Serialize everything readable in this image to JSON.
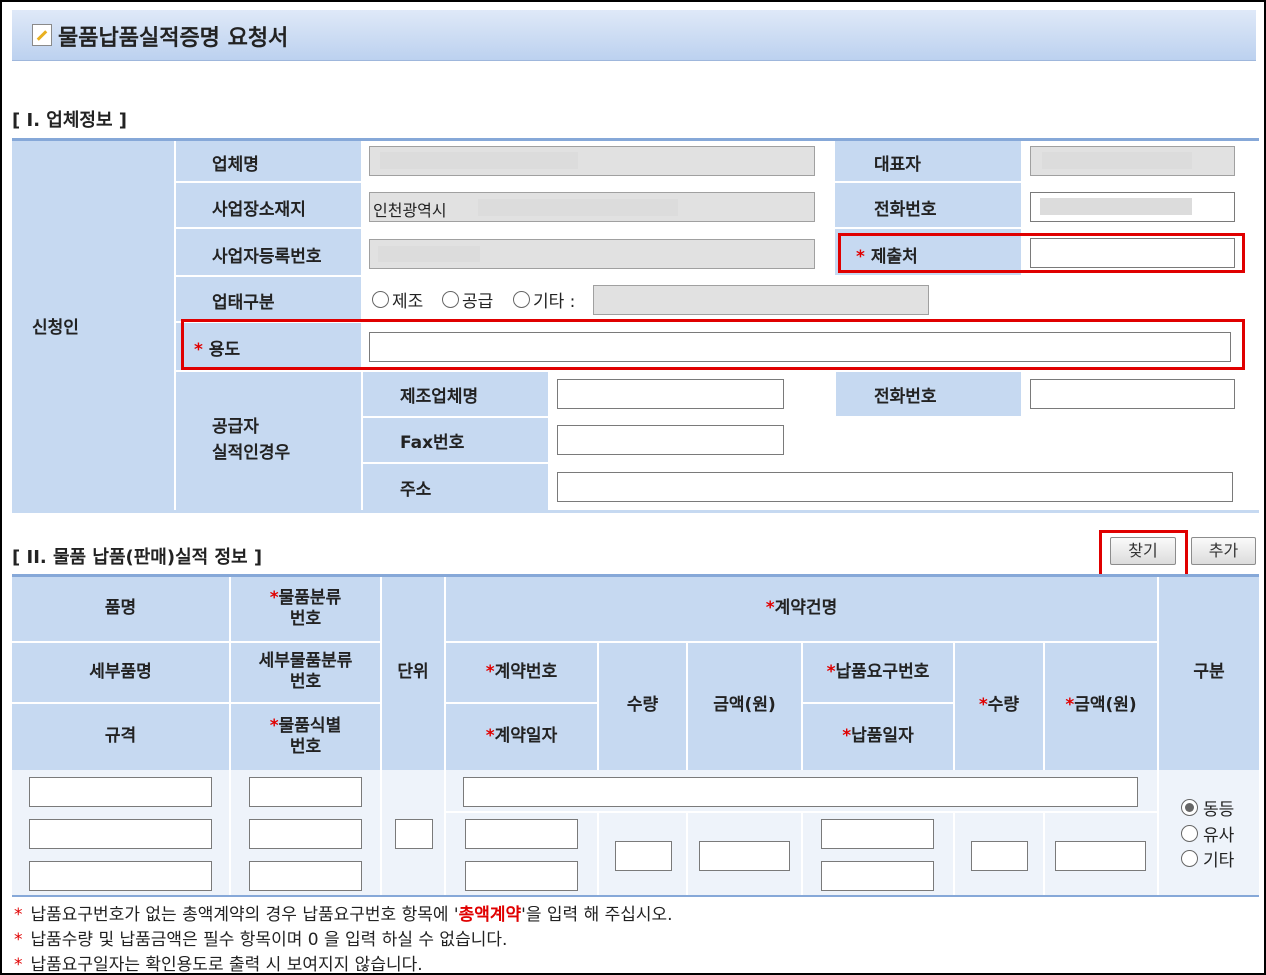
{
  "title": "물품납품실적증명 요청서",
  "section1": {
    "heading": "[ I. 업체정보 ]",
    "applicant_label": "신청인",
    "company_name_label": "업체명",
    "company_name_value": "",
    "representative_label": "대표자",
    "address_label": "사업장소재지",
    "address_value": "인천광역시",
    "phone_label": "전화번호",
    "business_number_label": "사업자등록번호",
    "submit_to_label": "제출처",
    "business_type_label": "업태구분",
    "business_type_options": [
      "제조",
      "공급",
      "기타 :"
    ],
    "purpose_label": "용도",
    "supplier_label_line1": "공급자",
    "supplier_label_line2": "실적인경우",
    "maker_name_label": "제조업체명",
    "maker_phone_label": "전화번호",
    "fax_label": "Fax번호",
    "maker_address_label": "주소",
    "required_mark": "*"
  },
  "section2": {
    "heading": "[ II. 물품 납품(판매)실적 정보 ]",
    "find_button": "찾기",
    "add_button": "추가",
    "headers": {
      "item_name": "품명",
      "goods_class_no_1": "물품분류",
      "goods_class_no_2": "번호",
      "contract_name": "계약건명",
      "detail_item_name": "세부품명",
      "detail_class_no_1": "세부물품분류",
      "detail_class_no_2": "번호",
      "unit": "단위",
      "contract_no": "계약번호",
      "quantity": "수량",
      "amount": "금액(원)",
      "delivery_request_no": "납품요구번호",
      "delivery_quantity": "수량",
      "delivery_amount": "금액(원)",
      "category": "구분",
      "spec": "규격",
      "goods_id_no_1": "물품식별",
      "goods_id_no_2": "번호",
      "contract_date": "계약일자",
      "delivery_date": "납품일자"
    },
    "category_options": [
      "동등",
      "유사",
      "기타"
    ],
    "category_selected": "동등"
  },
  "notes": {
    "mark": "*",
    "note1_prefix": "납품요구번호가 없는 총액계약의 경우 납품요구번호 항목에 '",
    "note1_highlight": "총액계약",
    "note1_suffix": "'을 입력 해 주십시오.",
    "note2": "납품수량 및 납품금액은 필수 항목이며 0 을 입력 하실 수 없습니다.",
    "note3": "납품요구일자는 확인용도로 출력 시 보여지지 않습니다."
  }
}
